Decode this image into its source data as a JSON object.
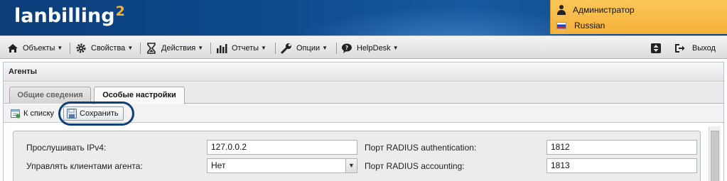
{
  "header": {
    "logo_text": "lanbilling",
    "logo_sup": "2",
    "user_name": "Администратор",
    "language": "Russian",
    "user_icon": "person-icon",
    "language_icon": "russia-flag-icon"
  },
  "menu": {
    "items": [
      {
        "label": "Объекты",
        "icon": "building-icon"
      },
      {
        "label": "Свойства",
        "icon": "gear-icon"
      },
      {
        "label": "Действия",
        "icon": "hourglass-icon"
      },
      {
        "label": "Отчеты",
        "icon": "bar-chart-icon"
      },
      {
        "label": "Опции",
        "icon": "wrench-icon"
      },
      {
        "label": "HelpDesk",
        "icon": "chat-bubble-icon"
      }
    ],
    "caret": "▼",
    "right": {
      "help_icon": "updown-arrows-icon",
      "logout_label": "Выход",
      "logout_icon": "logout-icon"
    }
  },
  "panel": {
    "title": "Агенты",
    "tabs": [
      {
        "label": "Общие сведения",
        "active": false
      },
      {
        "label": "Особые настройки",
        "active": true
      }
    ],
    "toolbar": {
      "back_label": "К списку",
      "save_label": "Сохранить"
    }
  },
  "form": {
    "listen_ipv4_label": "Прослушивать IPv4:",
    "listen_ipv4_value": "127.0.0.2",
    "manage_clients_label": "Управлять клиентами агента:",
    "manage_clients_value": "Нет",
    "radius_auth_label": "Порт RADIUS authentication:",
    "radius_auth_value": "1812",
    "radius_acct_label": "Порт RADIUS accounting:",
    "radius_acct_value": "1813"
  },
  "colors": {
    "header_blue": "#0e4c8d",
    "user_panel_orange": "#f6b23a",
    "logo_sup_orange": "#f2b33a",
    "highlight_ring": "#0f3f78"
  }
}
